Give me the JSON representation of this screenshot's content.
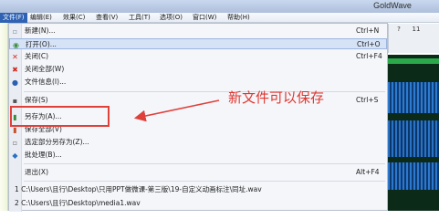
{
  "app": {
    "title": "GoldWave"
  },
  "menubar": [
    "文件(F)",
    "编辑(E)",
    "效果(C)",
    "查看(V)",
    "工具(T)",
    "选项(O)",
    "窗口(W)",
    "帮助(H)"
  ],
  "toolbar": {
    "button1": "?",
    "button2": "11"
  },
  "file_menu": {
    "items": [
      {
        "label": "新建(N)...",
        "shortcut": "Ctrl+N",
        "icon": "new-file-icon"
      },
      {
        "label": "打开(O)...",
        "shortcut": "Ctrl+O",
        "icon": "open-folder-icon"
      },
      {
        "label": "关闭(C)",
        "shortcut": "Ctrl+F4",
        "icon": "close-icon"
      },
      {
        "label": "关闭全部(W)",
        "shortcut": "",
        "icon": "close-all-icon"
      },
      {
        "label": "文件信息(I)...",
        "shortcut": "",
        "icon": "info-icon"
      },
      {
        "label": "保存(S)",
        "shortcut": "Ctrl+S",
        "icon": "save-icon"
      },
      {
        "label": "另存为(A)...",
        "shortcut": "",
        "icon": "save-as-icon"
      },
      {
        "label": "保存全部(V)",
        "shortcut": "",
        "icon": "save-all-icon"
      },
      {
        "label": "选定部分另存为(Z)...",
        "shortcut": "",
        "icon": "save-selection-icon"
      },
      {
        "label": "批处理(B)...",
        "shortcut": "",
        "icon": "batch-icon"
      },
      {
        "label": "退出(X)",
        "shortcut": "Alt+F4",
        "icon": ""
      },
      {
        "label": "1 C:\\Users\\且行\\Desktop\\只用PPT做微课-第三版\\19-自定义动画标注\\同址.wav",
        "shortcut": "",
        "icon": ""
      },
      {
        "label": "2 C:\\Users\\且行\\Desktop\\media1.wav",
        "shortcut": "",
        "icon": ""
      }
    ]
  },
  "annotation": {
    "text": "新文件可以保存",
    "color": "#e0362f"
  },
  "colors": {
    "menu_highlight": "#d6e3f7",
    "menubar_active": "#2f62b3",
    "annotation_red": "#e0403a"
  }
}
